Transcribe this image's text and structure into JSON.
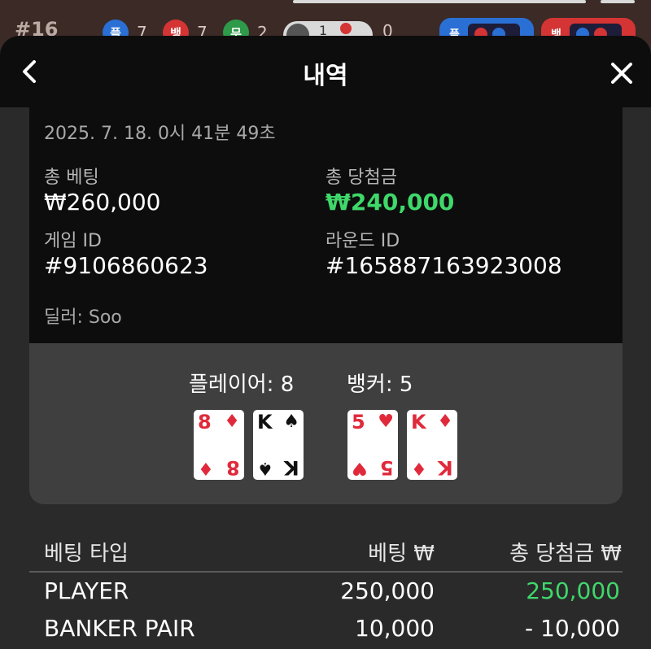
{
  "background": {
    "round": "#16",
    "player_badge": "플",
    "player_count": "7",
    "banker_badge": "뱅",
    "banker_count": "7",
    "tie_badge": "무",
    "tie_count": "2",
    "toggle_count": "1",
    "zero": "0",
    "chip_player": "플",
    "chip_banker": "뱅"
  },
  "header": {
    "title": "내역"
  },
  "summary": {
    "date": "2025. 7. 18. 0시 41분 49초",
    "total_bet_label": "총 베팅",
    "total_bet_value": "₩260,000",
    "total_win_label": "총 당첨금",
    "total_win_value": "₩240,000",
    "game_id_label": "게임 ID",
    "game_id_value": "#9106860623",
    "round_id_label": "라운드 ID",
    "round_id_value": "#165887163923008",
    "dealer": "딜러: Soo"
  },
  "hands": {
    "player_label": "플레이어: 8",
    "banker_label": "뱅커: 5",
    "player_cards": [
      {
        "rank": "8",
        "suit": "♦",
        "color": "red"
      },
      {
        "rank": "K",
        "suit": "♠",
        "color": "black"
      }
    ],
    "banker_cards": [
      {
        "rank": "5",
        "suit": "♥",
        "color": "red"
      },
      {
        "rank": "K",
        "suit": "♦",
        "color": "red"
      }
    ]
  },
  "table": {
    "col_type": "베팅 타입",
    "col_bet": "베팅 ₩",
    "col_win": "총 당첨금 ₩",
    "rows": [
      {
        "type": "PLAYER",
        "bet": "250,000",
        "win": "250,000"
      },
      {
        "type": "BANKER PAIR",
        "bet": "10,000",
        "win": "- 10,000"
      }
    ]
  },
  "colors": {
    "win_green": "#3fd86a",
    "card_red": "#e02a3b"
  }
}
